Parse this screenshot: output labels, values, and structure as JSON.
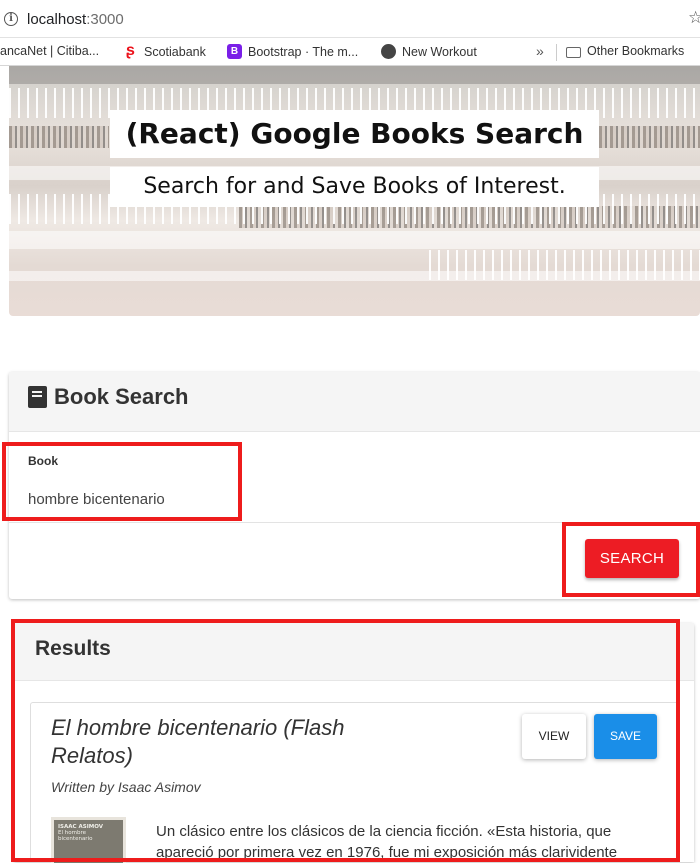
{
  "browser": {
    "url_host": "localhost",
    "url_port": ":3000",
    "bookmarks": [
      {
        "label": "ancaNet | Citiba...",
        "icon": "none"
      },
      {
        "label": "Scotiabank",
        "icon": "scotiabank-icon"
      },
      {
        "label": "Bootstrap · The m...",
        "icon": "bootstrap-icon"
      },
      {
        "label": "New Workout",
        "icon": "globe-icon"
      }
    ],
    "more": "»",
    "other_bookmarks": "Other Bookmarks"
  },
  "hero": {
    "title": "(React) Google Books Search",
    "subtitle": "Search for and Save Books of Interest."
  },
  "search": {
    "title": "Book Search",
    "field_label": "Book",
    "field_value": "hombre bicentenario",
    "button_label": "SEARCH"
  },
  "results": {
    "title": "Results",
    "items": [
      {
        "title": "El hombre bicentenario (Flash Relatos)",
        "author": "Written by Isaac Asimov",
        "view_label": "VIEW",
        "save_label": "SAVE",
        "cover_author": "ISAAC ASIMOV",
        "cover_title": "El hombre bicentenario",
        "description": "Un clásico entre los clásicos de la ciencia ficción. «Esta historia, que apareció por primera vez en 1976, fue mi exposición más clarividente"
      }
    ]
  },
  "colors": {
    "search_button": "#ed1c24",
    "save_button": "#1a8ee8",
    "highlight": "#ee1c1c"
  }
}
